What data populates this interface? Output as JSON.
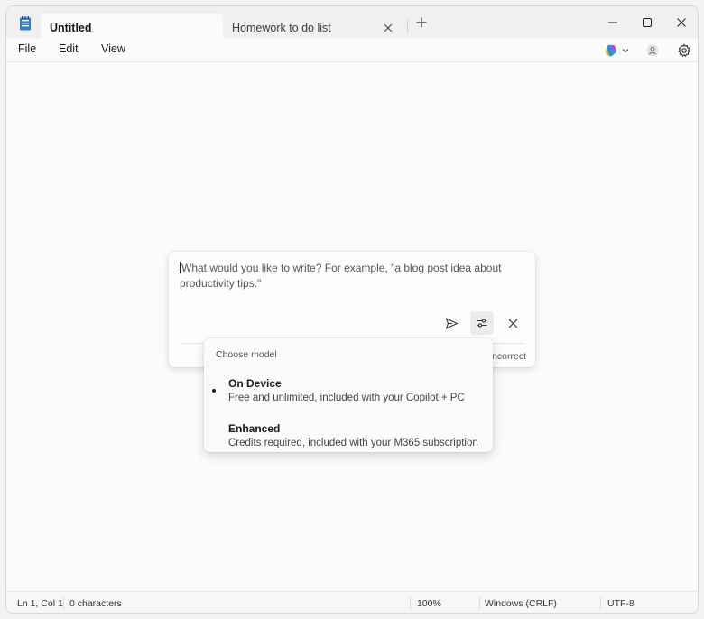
{
  "tabs": [
    {
      "label": "Untitled"
    },
    {
      "label": "Homework to do list"
    }
  ],
  "menu": {
    "file": "File",
    "edit": "Edit",
    "view": "View"
  },
  "write": {
    "prompt": "What would you like to write? For example, \"a blog post idea about productivity tips.\"",
    "footer_text": "ncorrect"
  },
  "model_menu": {
    "header": "Choose model",
    "options": [
      {
        "title": "On Device",
        "description": "Free and unlimited, included with your Copilot + PC",
        "selected": true
      },
      {
        "title": "Enhanced",
        "description": "Credits required, included with your M365 subscription",
        "selected": false
      }
    ]
  },
  "status": {
    "position": "Ln 1, Col 1",
    "characters": "0 characters",
    "zoom": "100%",
    "line_ending": "Windows (CRLF)",
    "encoding": "UTF-8"
  },
  "colors": {
    "accent": "#005fb8",
    "copilot_gradient": [
      "#2b8cf6",
      "#d23dd8",
      "#f5b400"
    ]
  }
}
